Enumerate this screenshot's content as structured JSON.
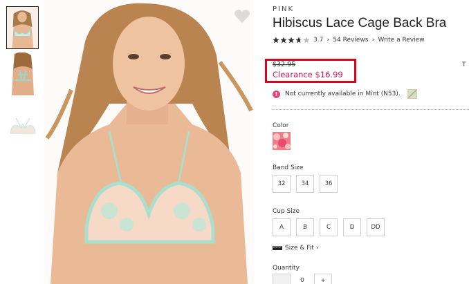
{
  "thumbnails": [
    {
      "label": "model front view",
      "selected": true
    },
    {
      "label": "model back view",
      "selected": false
    },
    {
      "label": "bra flat lay",
      "selected": false
    }
  ],
  "product": {
    "brand": "PINK",
    "title": "Hibiscus Lace Cage Back Bra",
    "rating": "3.7",
    "rating_value": 3.7,
    "reviews_link": "54 Reviews",
    "write_review_link": "Write a Review",
    "price_old": "$32.95",
    "price_new": "Clearance $16.99",
    "cut_off_text": "T",
    "availability": "Not currently available in Mint (N53)."
  },
  "sections": {
    "color_label": "Color",
    "band_label": "Band Size",
    "cup_label": "Cup Size",
    "size_fit": "Size & Fit",
    "quantity_label": "Quantity"
  },
  "band_sizes": [
    "32",
    "34",
    "36"
  ],
  "cup_sizes": [
    "A",
    "B",
    "C",
    "D",
    "DD"
  ],
  "quantity": {
    "minus": "",
    "value": "0",
    "plus": "+"
  },
  "colors": {
    "accent_red": "#e0001b",
    "sale_pink": "#cc1553",
    "alert_pink": "#e0457b",
    "bra_mint": "#a9dfcc"
  }
}
